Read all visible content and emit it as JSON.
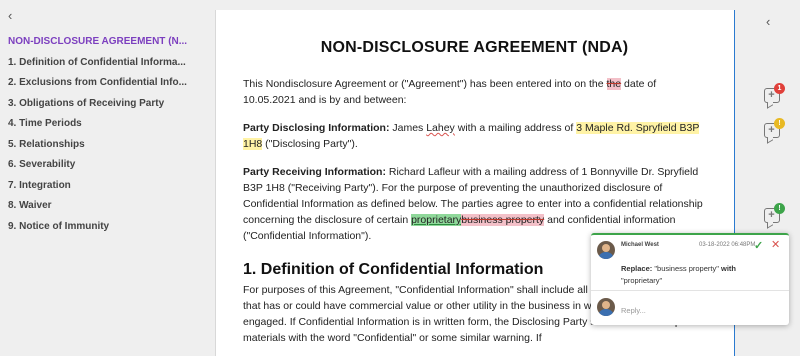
{
  "outline": {
    "collapse_glyph": "‹",
    "items": [
      {
        "label": "NON-DISCLOSURE AGREEMENT (N..."
      },
      {
        "label": "1. Definition of Confidential Informa..."
      },
      {
        "label": "2. Exclusions from Confidential Info..."
      },
      {
        "label": "3. Obligations of Receiving Party"
      },
      {
        "label": "4. Time Periods"
      },
      {
        "label": "5. Relationships"
      },
      {
        "label": "6. Severability"
      },
      {
        "label": "7. Integration"
      },
      {
        "label": "8. Waiver"
      },
      {
        "label": "9. Notice of Immunity"
      }
    ]
  },
  "document": {
    "title": "NON-DISCLOSURE AGREEMENT (NDA)",
    "intro_a": "This Nondisclosure Agreement or (\"Agreement\") has been entered into on the ",
    "intro_deleted": "the",
    "intro_b": " date of 10.05.2021 and is by and between:",
    "disclosing_label": "Party Disclosing Information:",
    "disclosing_a": " James ",
    "disclosing_name": "Lahey",
    "disclosing_b": " with a mailing address of ",
    "disclosing_address": "3 Maple Rd. Spryfield B3P 1H8",
    "disclosing_c": "  (\"Disclosing Party\").",
    "receiving_label": "Party Receiving Information:",
    "receiving_a": "  Richard Lafleur with a mailing address of  1 Bonnyville Dr. Spryfield B3P 1H8 (\"Receiving Party\"). For the purpose of preventing the unauthorized disclosure of Confidential Information as defined below. The parties agree to enter into a confidential relationship concerning the disclosure of certain ",
    "receiving_inserted": "proprietary",
    "receiving_deleted": "business property",
    "receiving_b": " and confidential information (\"Confidential Information\").",
    "section1_heading": "1. Definition of Confidential Information",
    "section1_body": "For purposes of this Agreement, \"Confidential Information\" shall include all information or material that has or could have commercial value or other utility in the business in which Disclosing Party is engaged. If Confidential Information is in written form, the Disclosing Party shall label or stamp the materials with the word \"Confidential\" or some similar warning. If"
  },
  "rail": {
    "collapse_glyph": "‹",
    "icons": [
      {
        "name": "comment-icon",
        "badge": "1",
        "badge_color": "#e0403a"
      },
      {
        "name": "comment-icon",
        "badge": "!",
        "badge_color": "#e8b923"
      },
      {
        "name": "comment-add-icon",
        "badge": "!",
        "badge_color": "#3da44a"
      }
    ]
  },
  "popup": {
    "author": "Michael West",
    "date": "03-18-2022 06:48PM",
    "accept_glyph": "✓",
    "reject_glyph": "✕",
    "change_label": "Replace:",
    "change_new": "\"business property\"",
    "change_with": "with",
    "change_old": "\"proprietary\"",
    "reply_placeholder": "Reply..."
  }
}
